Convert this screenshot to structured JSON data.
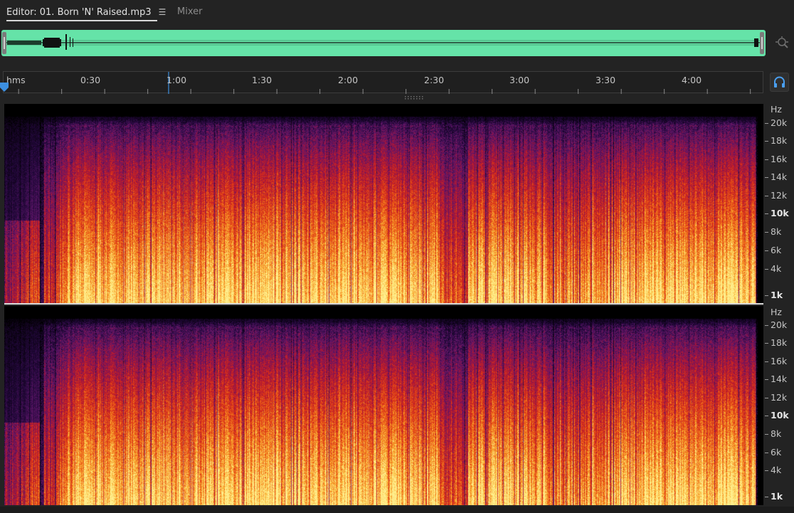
{
  "tabs": {
    "editor": {
      "label": "Editor: 01. Born 'N' Raised.mp3",
      "menu_icon": "hamburger-menu-icon",
      "active": true
    },
    "mixer": {
      "label": "Mixer",
      "active": false
    }
  },
  "overview": {
    "zoom_icon": "zoom-to-selection-icon"
  },
  "timeline": {
    "format_label": "hms",
    "labels": [
      "0:30",
      "1:00",
      "1:30",
      "2:00",
      "2:30",
      "3:00",
      "3:30",
      "4:00"
    ],
    "headphones_icon": "headphones-icon",
    "accent_color": "#3d8fe0"
  },
  "frequency_axis": {
    "unit": "Hz",
    "labels": [
      "20k",
      "18k",
      "16k",
      "14k",
      "12k",
      "10k",
      "8k",
      "6k",
      "4k",
      "1k"
    ]
  },
  "colors": {
    "overview_waveform": "#65e3a8",
    "background": "#232323"
  }
}
